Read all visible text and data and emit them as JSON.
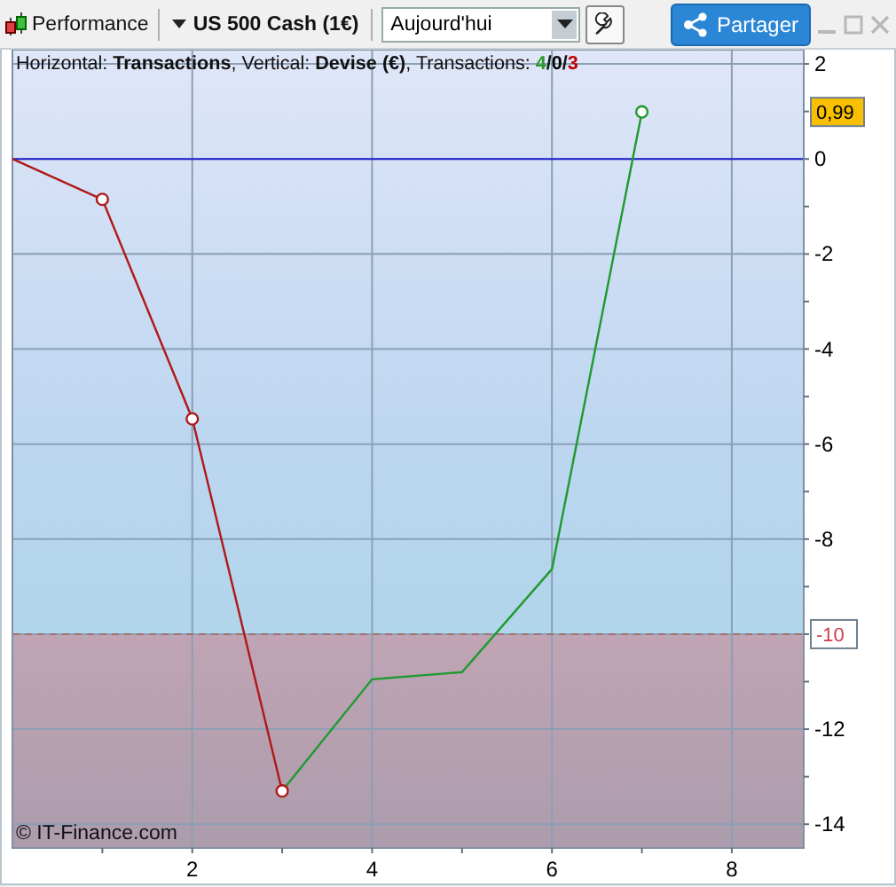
{
  "toolbar": {
    "title": "Performance",
    "instrument": "US 500 Cash (1€)",
    "period": "Aujourd'hui",
    "share": "Partager",
    "window_controls_disabled": true
  },
  "chart": {
    "info": {
      "text": "Horizontal: **Transactions**, Vertical: **Devise (€)**, Transactions: ",
      "counts": [
        {
          "value": "4",
          "color": "#2a9a2a"
        },
        {
          "value": "0",
          "color": "#000000"
        },
        {
          "value": "3",
          "color": "#c00000"
        }
      ],
      "separators": [
        "/",
        "/"
      ]
    },
    "last_value": "0,99",
    "threshold_label": "-10",
    "copyright": "© IT-Finance.com",
    "chart_data": {
      "type": "line",
      "grid": true,
      "ref_lines": [
        {
          "axis": "y",
          "value": 0,
          "color": "#2020d0"
        },
        {
          "axis": "y",
          "value": -10,
          "color": "#a07070"
        }
      ],
      "x": [
        0,
        1,
        2,
        3,
        4,
        5,
        6,
        7
      ],
      "xlim": [
        0,
        8.8
      ],
      "ylim": [
        -14.5,
        2.3
      ],
      "xticks": [
        2,
        4,
        6,
        8
      ],
      "yticks": [
        -14,
        -12,
        -10,
        -8,
        -6,
        -4,
        -2,
        0,
        2
      ],
      "series": [
        {
          "color": "#b01818",
          "values": [
            0,
            -0.85,
            -5.47,
            -13.3,
            null,
            null,
            null,
            null
          ]
        },
        {
          "color": "#1e9a2e",
          "values": [
            null,
            null,
            null,
            -13.3,
            -10.95,
            -10.8,
            -8.63,
            0.99
          ]
        }
      ]
    }
  }
}
